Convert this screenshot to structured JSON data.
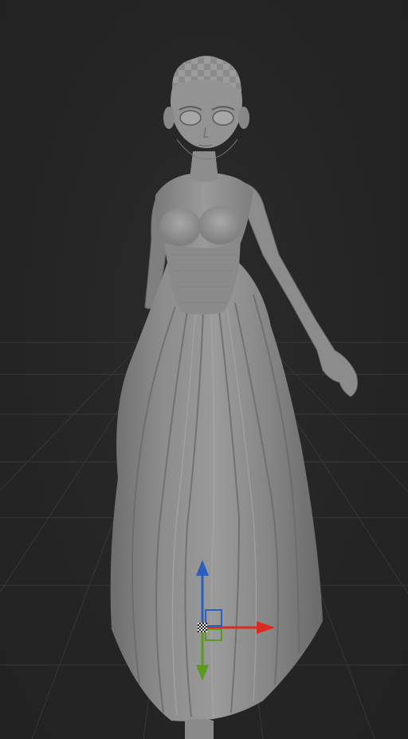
{
  "viewport": {
    "background": "#252525",
    "grid_color": "#3a3a3a",
    "model_color": "#8f8f8f",
    "model_shadow": "#5e5e5e",
    "model_highlight": "#b3b3b3"
  },
  "gizmo": {
    "x_axis_color": "#d92b1f",
    "y_axis_color": "#5a9a1e",
    "z_axis_color": "#2a5fc0",
    "pivot_icon": "checker-pivot-icon"
  }
}
